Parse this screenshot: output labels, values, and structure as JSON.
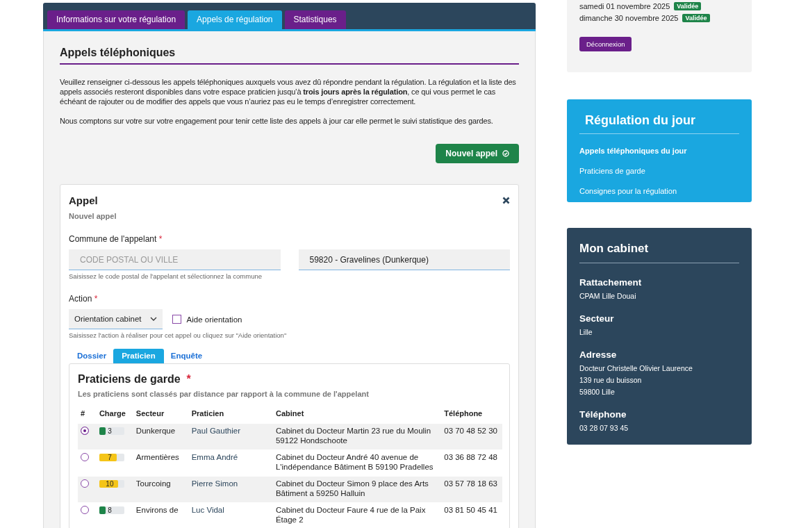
{
  "session_card": {
    "dates": [
      {
        "label": "samedi 01 novembre 2025",
        "badge": "Validée"
      },
      {
        "label": "dimanche 30 novembre 2025",
        "badge": "Validée"
      }
    ],
    "logout_button": "Déconnexion"
  },
  "main_tabs": [
    {
      "label": "Informations sur votre régulation",
      "selected": false
    },
    {
      "label": "Appels de régulation",
      "selected": true
    },
    {
      "label": "Statistiques",
      "selected": false
    }
  ],
  "section": {
    "title": "Appels téléphoniques",
    "paragraphs": [
      "Veuillez renseigner ci-dessous les appels téléphoniques auxquels vous avez dû répondre pendant la régulation. La régulation et la liste des appels associés resteront disponibles dans votre espace praticien jusqu’à **trois jours après la régulation**, ce qui vous permet le cas échéant de rajouter ou de modifier des appels que vous n’auriez pas eu le temps d’enregistrer correctement.",
      "Nous comptons sur votre sur votre engagement pour tenir cette liste des appels à jour car elle permet le suivi statistique des gardes."
    ],
    "new_call_button": "Nouvel appel"
  },
  "call_form": {
    "title": "Appel",
    "subtitle": "Nouvel appel",
    "commune": {
      "label": "Commune de l'appelant",
      "required_mark": "*",
      "search": {
        "placeholder": "CODE POSTAL OU VILLE"
      },
      "selected_value": "59820 - Gravelines (Dunkerque)",
      "hint": "Saisissez le code postal de l'appelant et sélectionnez la commune"
    },
    "action": {
      "label": "Action",
      "required_mark": "*",
      "value": "Orientation cabinet",
      "aid": {
        "label": "Aide orientation",
        "checked": false
      },
      "hint": "Saisissez l'action à réaliser pour cet appel ou cliquez sur \"Aide orientation\""
    },
    "sub_tabs": [
      {
        "label": "Dossier",
        "selected": false
      },
      {
        "label": "Praticien",
        "selected": true
      },
      {
        "label": "Enquête",
        "selected": false
      }
    ],
    "practitioners": {
      "title": "Praticiens de garde",
      "required_mark": "*",
      "subtitle": "Les praticiens sont classés par distance par rapport à la commune de l'appelant",
      "columns": [
        "#",
        "Charge",
        "Secteur",
        "Praticien",
        "Cabinet",
        "Téléphone"
      ],
      "rows": [
        {
          "selected": true,
          "charge": {
            "value": "3",
            "level": 0.25,
            "color": "#1e8449"
          },
          "secteur": "Dunkerque",
          "praticien": "Paul Gauthier",
          "cabinet": "Cabinet du Docteur Martin 23 rue du Moulin 59122 Hondschoote",
          "telephone": "03 70 48 52 30"
        },
        {
          "selected": false,
          "charge": {
            "value": "7",
            "level": 0.7,
            "color": "#f5c518"
          },
          "secteur": "Armentières",
          "praticien": "Emma André",
          "cabinet": "Cabinet du Docteur André 40 avenue de L'indépendance Bâtiment B 59190 Pradelles",
          "telephone": "03 36 88 72 48"
        },
        {
          "selected": false,
          "charge": {
            "value": "10",
            "level": 0.75,
            "color": "#f5c518"
          },
          "secteur": "Tourcoing",
          "praticien": "Pierre Simon",
          "cabinet": "Cabinet du Docteur Simon 9 place des Arts Bâtiment a 59250 Halluin",
          "telephone": "03 57 78 18 63"
        },
        {
          "selected": false,
          "charge": {
            "value": "8",
            "level": 0.25,
            "color": "#1e8449"
          },
          "secteur": "Environs de",
          "praticien": "Luc Vidal",
          "cabinet": "Cabinet du Docteur Faure 4 rue de la Paix Étage 2",
          "telephone": "03 81 50 45 41"
        }
      ]
    }
  },
  "day_card": {
    "title": "Régulation du jour",
    "links": [
      {
        "label": "Appels téléphoniques du jour",
        "selected": true
      },
      {
        "label": "Praticiens de garde",
        "selected": false
      },
      {
        "label": "Consignes pour la régulation",
        "selected": false
      }
    ]
  },
  "cabinet_card": {
    "title": "Mon cabinet",
    "sections": [
      {
        "heading": "Rattachement",
        "lines": [
          "CPAM Lille Douai"
        ]
      },
      {
        "heading": "Secteur",
        "lines": [
          "Lille"
        ]
      },
      {
        "heading": "Adresse",
        "lines": [
          "Docteur Christelle Olivier Laurence",
          "139 rue du buisson",
          "59800 Lille"
        ]
      },
      {
        "heading": "Téléphone",
        "lines": [
          "03 28 07 93 45"
        ]
      }
    ]
  }
}
